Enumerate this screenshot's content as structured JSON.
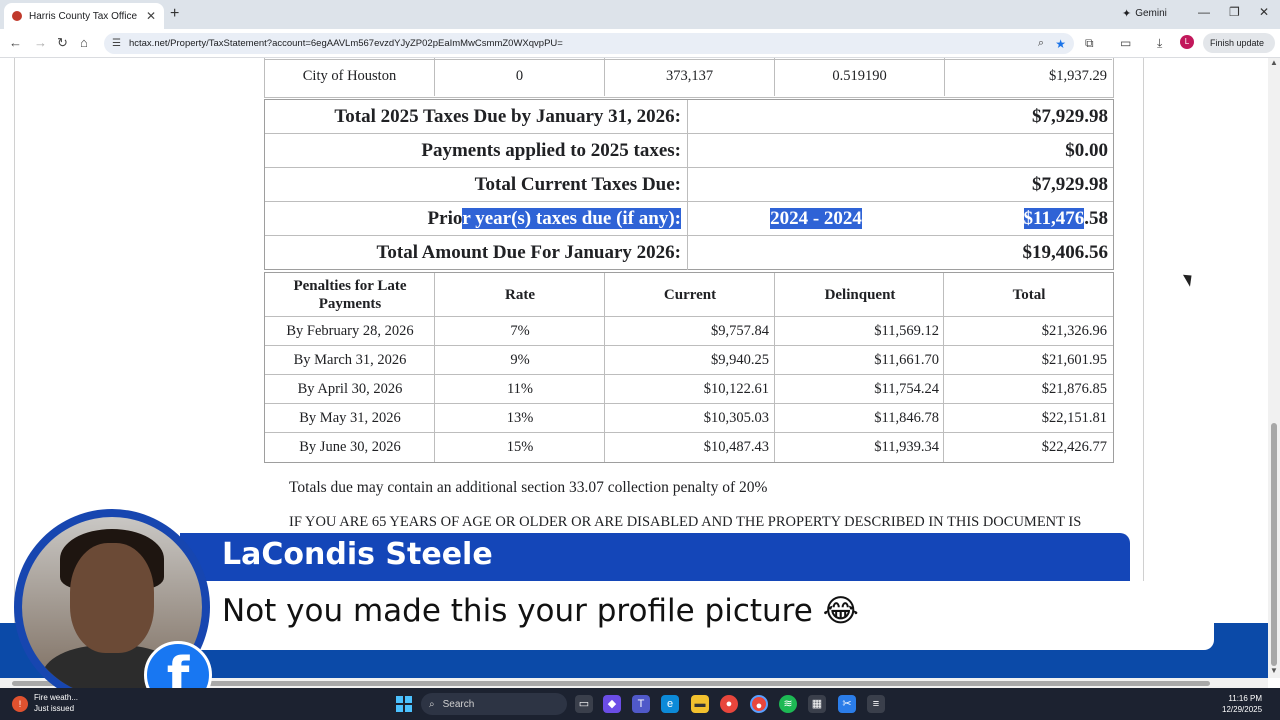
{
  "browser": {
    "tab_title": "Harris County Tax Office",
    "new_tab": "+",
    "tab_close": "✕",
    "gemini_label": "Gemini",
    "url": "hctax.net/Property/TaxStatement?account=6egAAVLm567evzdYJyZP02pEaImMwCsmmZ0WXqvpPU=",
    "finish_update": "Finish update",
    "profile_initial": "L"
  },
  "statement": {
    "top_row": {
      "jurisdiction": "City of Houston",
      "exemption": "0",
      "taxable_value": "373,137",
      "rate": "0.519190",
      "tax": "$1,937.29"
    },
    "totals": [
      {
        "label": "Total 2025 Taxes Due by January 31, 2026:",
        "middle": "",
        "amount": "$7,929.98"
      },
      {
        "label": "Payments applied to 2025 taxes:",
        "middle": "",
        "amount": "$0.00"
      },
      {
        "label": "Total Current Taxes Due:",
        "middle": "",
        "amount": "$7,929.98"
      },
      {
        "label_plain": "Prio",
        "label_highlight": "r year(s) taxes due (if any):",
        "middle": "2024 - 2024",
        "amount_highlight": "$11,476",
        "amount_plain": ".58"
      },
      {
        "label": "Total Amount Due For January 2026:",
        "middle": "",
        "amount": "$19,406.56"
      }
    ],
    "penalties": {
      "headers": [
        "Penalties for Late Payments",
        "Rate",
        "Current",
        "Delinquent",
        "Total"
      ],
      "rows": [
        [
          "By February 28, 2026",
          "7%",
          "$9,757.84",
          "$11,569.12",
          "$21,326.96"
        ],
        [
          "By March 31, 2026",
          "9%",
          "$9,940.25",
          "$11,661.70",
          "$21,601.95"
        ],
        [
          "By April 30, 2026",
          "11%",
          "$10,122.61",
          "$11,754.24",
          "$21,876.85"
        ],
        [
          "By May 31, 2026",
          "13%",
          "$10,305.03",
          "$11,846.78",
          "$22,151.81"
        ],
        [
          "By June 30, 2026",
          "15%",
          "$10,487.43",
          "$11,939.34",
          "$22,426.77"
        ]
      ]
    },
    "note": "Totals due may contain an additional section 33.07 collection penalty of 20%",
    "note2": "IF YOU ARE 65 YEARS OF AGE OR OLDER OR ARE DISABLED AND THE PROPERTY DESCRIBED IN THIS DOCUMENT IS"
  },
  "overlay": {
    "name": "LaCondis Steele",
    "comment": "Not you made this your profile picture 😂",
    "fb_logo": "f"
  },
  "taskbar": {
    "weather_line1": "Fire weath...",
    "weather_line2": "Just issued",
    "search_placeholder": "Search",
    "time": "11:16 PM",
    "date": "12/29/2025"
  }
}
